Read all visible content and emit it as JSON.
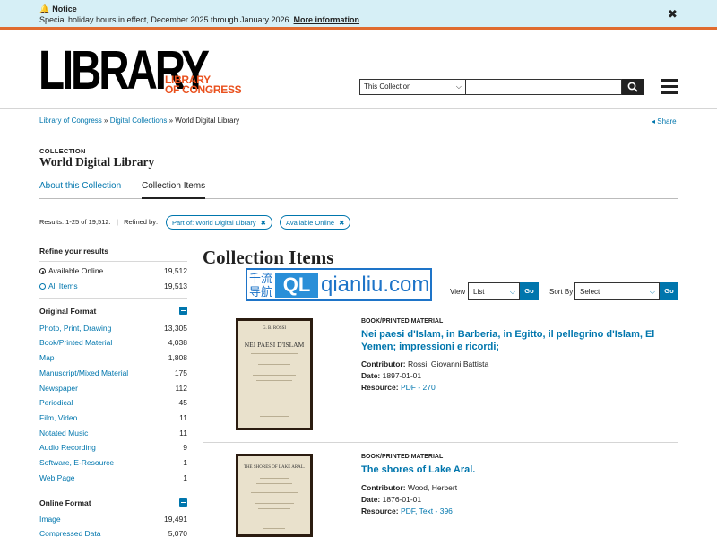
{
  "notice": {
    "title": "Notice",
    "text": "Special holiday hours in effect, December 2025 through January 2026.",
    "link": "More information"
  },
  "header": {
    "logo": "LIBRARY",
    "logo_sub_line1": "LIBRARY",
    "logo_sub_line2": "OF CONGRESS",
    "search_scope": "This Collection",
    "search_placeholder": ""
  },
  "breadcrumb": {
    "items": [
      "Library of Congress",
      "Digital Collections",
      "World Digital Library"
    ],
    "sep": "»",
    "share": "Share"
  },
  "collection": {
    "label": "COLLECTION",
    "title": "World Digital Library"
  },
  "tabs": [
    "About this Collection",
    "Collection Items"
  ],
  "results": {
    "text": "Results: 1-25 of 19,512.",
    "divider": "|",
    "refined_by": "Refined by:",
    "chips": [
      "Part of: World Digital Library",
      "Available Online"
    ]
  },
  "sidebar": {
    "refine_heading": "Refine your results",
    "availability": [
      {
        "label": "Available Online",
        "count": "19,512",
        "selected": true
      },
      {
        "label": "All Items",
        "count": "19,513",
        "selected": false
      }
    ],
    "original_format": {
      "heading": "Original Format",
      "items": [
        {
          "label": "Photo, Print, Drawing",
          "count": "13,305"
        },
        {
          "label": "Book/Printed Material",
          "count": "4,038"
        },
        {
          "label": "Map",
          "count": "1,808"
        },
        {
          "label": "Manuscript/Mixed Material",
          "count": "175"
        },
        {
          "label": "Newspaper",
          "count": "112"
        },
        {
          "label": "Periodical",
          "count": "45"
        },
        {
          "label": "Film, Video",
          "count": "11"
        },
        {
          "label": "Notated Music",
          "count": "11"
        },
        {
          "label": "Audio Recording",
          "count": "9"
        },
        {
          "label": "Software, E-Resource",
          "count": "1"
        },
        {
          "label": "Web Page",
          "count": "1"
        }
      ]
    },
    "online_format": {
      "heading": "Online Format",
      "items": [
        {
          "label": "Image",
          "count": "19,491"
        },
        {
          "label": "Compressed Data",
          "count": "5,070"
        }
      ]
    }
  },
  "main": {
    "title": "Collection Items",
    "watermark": {
      "cn": "千流导航",
      "ql": "QL",
      "domain": "qianliu.com"
    },
    "view_label": "View",
    "view_value": "List",
    "sort_label": "Sort By",
    "sort_value": "Select",
    "go": "Go",
    "items": [
      {
        "format": "BOOK/PRINTED MATERIAL",
        "title": "Nei paesi d'Islam, in Barberia, in Egitto, il pellegrino d'Islam, El Yemen; impressioni e ricordi;",
        "contributor_label": "Contributor:",
        "contributor": "Rossi, Giovanni Battista",
        "date_label": "Date:",
        "date": "1897-01-01",
        "resource_label": "Resource:",
        "resource": "PDF - 270",
        "thumb_text": "NEI PAESI D'ISLAM",
        "thumb_author": "G. B. ROSSI"
      },
      {
        "format": "BOOK/PRINTED MATERIAL",
        "title": "The shores of Lake Aral.",
        "contributor_label": "Contributor:",
        "contributor": "Wood, Herbert",
        "date_label": "Date:",
        "date": "1876-01-01",
        "resource_label": "Resource:",
        "resource": "PDF, Text - 396",
        "thumb_text": "THE SHORES OF LAKE ARAL.",
        "thumb_author": ""
      }
    ]
  }
}
